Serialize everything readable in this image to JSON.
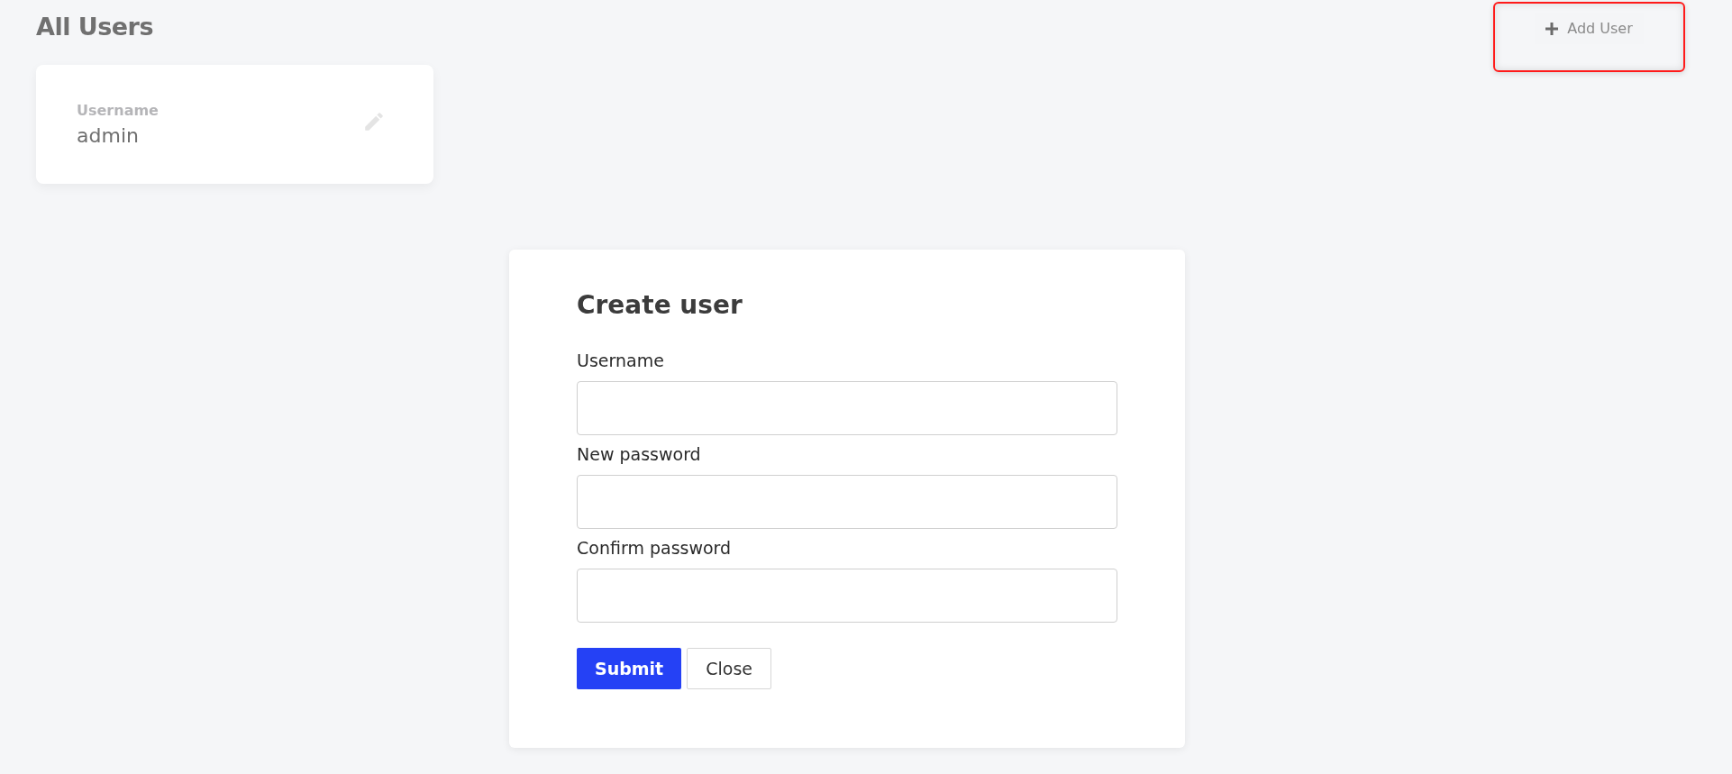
{
  "page_title": "All Users",
  "add_button": {
    "label": "Add User",
    "highlighted": true
  },
  "users": [
    {
      "field_label": "Username",
      "value": "admin"
    }
  ],
  "dialog": {
    "title": "Create user",
    "fields": [
      {
        "label": "Username"
      },
      {
        "label": "New password"
      },
      {
        "label": "Confirm password"
      }
    ],
    "buttons": [
      {
        "label": "Submit",
        "kind": "primary"
      },
      {
        "label": "Close",
        "kind": "secondary"
      }
    ]
  }
}
